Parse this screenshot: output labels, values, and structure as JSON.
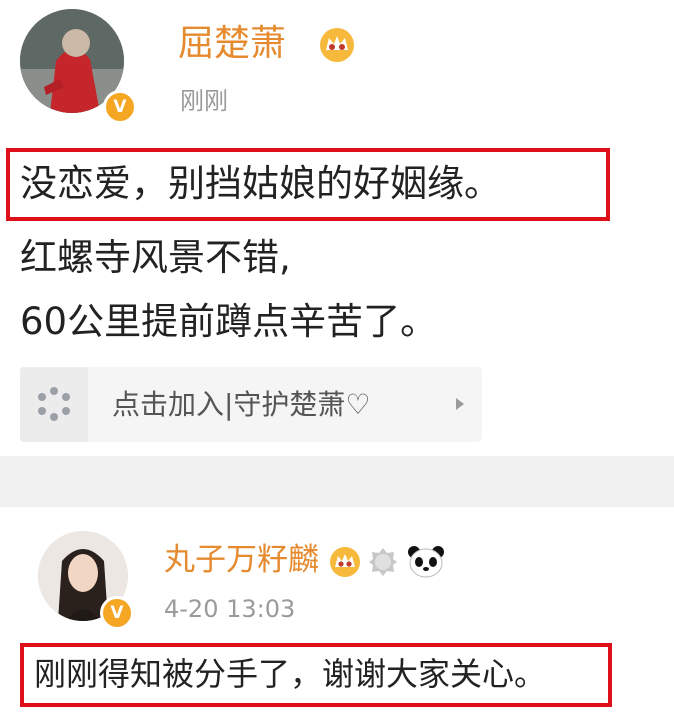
{
  "post1": {
    "user_name": "屈楚萧",
    "time": "刚刚",
    "highlighted_text": "没恋爱，别挡姑娘的好姻缘。",
    "lines": [
      "红螺寺风景不错,",
      "60公里提前蹲点辛苦了。"
    ],
    "join_label": "点击加入|守护楚萧♡"
  },
  "post2": {
    "user_name": "丸子万籽麟",
    "time": "4-20 13:03",
    "highlighted_text": "刚刚得知被分手了，谢谢大家关心。"
  },
  "colors": {
    "name": "#e58a2e",
    "highlight_border": "#e0101a",
    "verified": "#f5a623",
    "time": "#9a9a9a"
  },
  "icons": {
    "verified": "verified-v-icon",
    "vip_crown": "vip-crown-icon",
    "join_app": "app-dots-icon",
    "chevron": "chevron-right-icon",
    "panda": "panda-icon",
    "fan_badge": "fan-badge-icon"
  }
}
